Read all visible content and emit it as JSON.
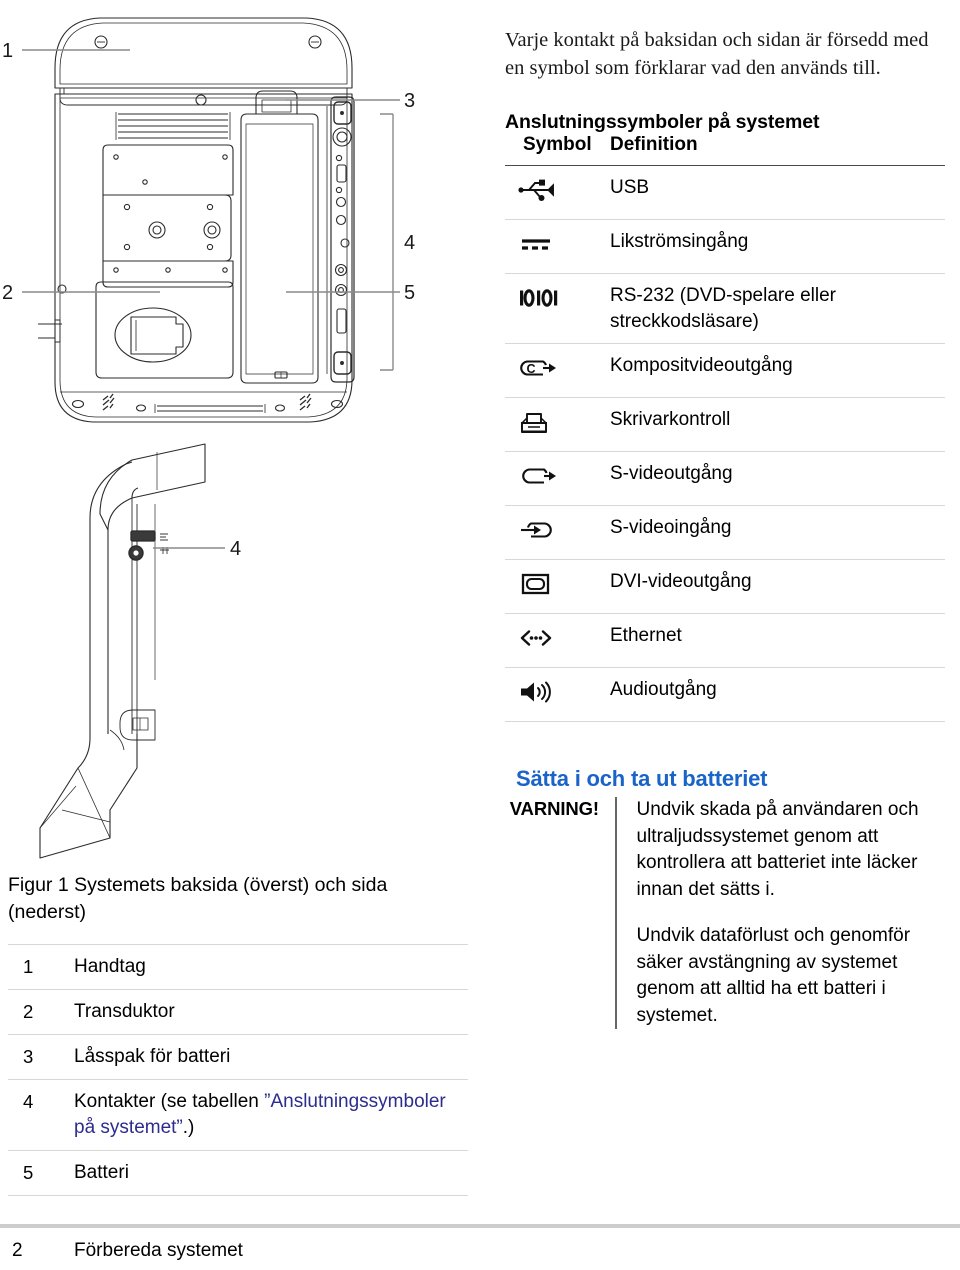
{
  "page": {
    "intro_paragraph": "Varje kontakt på baksidan och sidan är försedd med en symbol som förklarar vad den används till.",
    "symbols_heading": "Anslutningssymboler på systemet",
    "battery_heading": "Sätta i och ta ut batteriet",
    "accent_blue": "#1a63c8",
    "link_blue": "#2c2c8e"
  },
  "symbol_table": {
    "col_symbol": "Symbol",
    "col_definition": "Definition",
    "rows": [
      {
        "icon": "usb-icon",
        "definition": "USB"
      },
      {
        "icon": "dc-power-input-icon",
        "definition": "Likströmsingång"
      },
      {
        "icon": "serial-rs232-icon",
        "definition": "RS-232 (DVD-spelare eller streckkodsläsare)"
      },
      {
        "icon": "composite-video-out-icon",
        "definition": "Kompositvideoutgång"
      },
      {
        "icon": "printer-control-icon",
        "definition": "Skrivarkontroll"
      },
      {
        "icon": "s-video-out-icon",
        "definition": "S-videoutgång"
      },
      {
        "icon": "s-video-in-icon",
        "definition": "S-videoingång"
      },
      {
        "icon": "dvi-video-out-icon",
        "definition": "DVI-videoutgång"
      },
      {
        "icon": "ethernet-icon",
        "definition": "Ethernet"
      },
      {
        "icon": "audio-out-icon",
        "definition": "Audioutgång"
      }
    ]
  },
  "warning": {
    "label": "VARNING!",
    "paragraphs": [
      "Undvik skada på användaren och ultraljudssystemet genom att kontrollera att batteriet inte läcker innan det sätts i.",
      "Undvik dataförlust och genomför säker avstängning av systemet genom att alltid ha ett batteri i systemet."
    ]
  },
  "figure": {
    "caption": "Figur 1  Systemets baksida (överst) och sida (nederst)",
    "callouts_top": [
      "1",
      "2",
      "3",
      "4",
      "5"
    ],
    "callouts_bottom": [
      "4"
    ],
    "legend": [
      {
        "num": "1",
        "label": "Handtag",
        "link": ""
      },
      {
        "num": "2",
        "label": "Transduktor",
        "link": ""
      },
      {
        "num": "3",
        "label": "Låsspak för batteri",
        "link": ""
      },
      {
        "num": "4",
        "label_pre": "Kontakter (se tabellen ",
        "link": "”Anslutningssymboler på systemet”",
        "label_post": ".)"
      },
      {
        "num": "5",
        "label": "Batteri",
        "link": ""
      }
    ]
  },
  "footer": {
    "page_number": "2",
    "section": "Förbereda systemet"
  }
}
